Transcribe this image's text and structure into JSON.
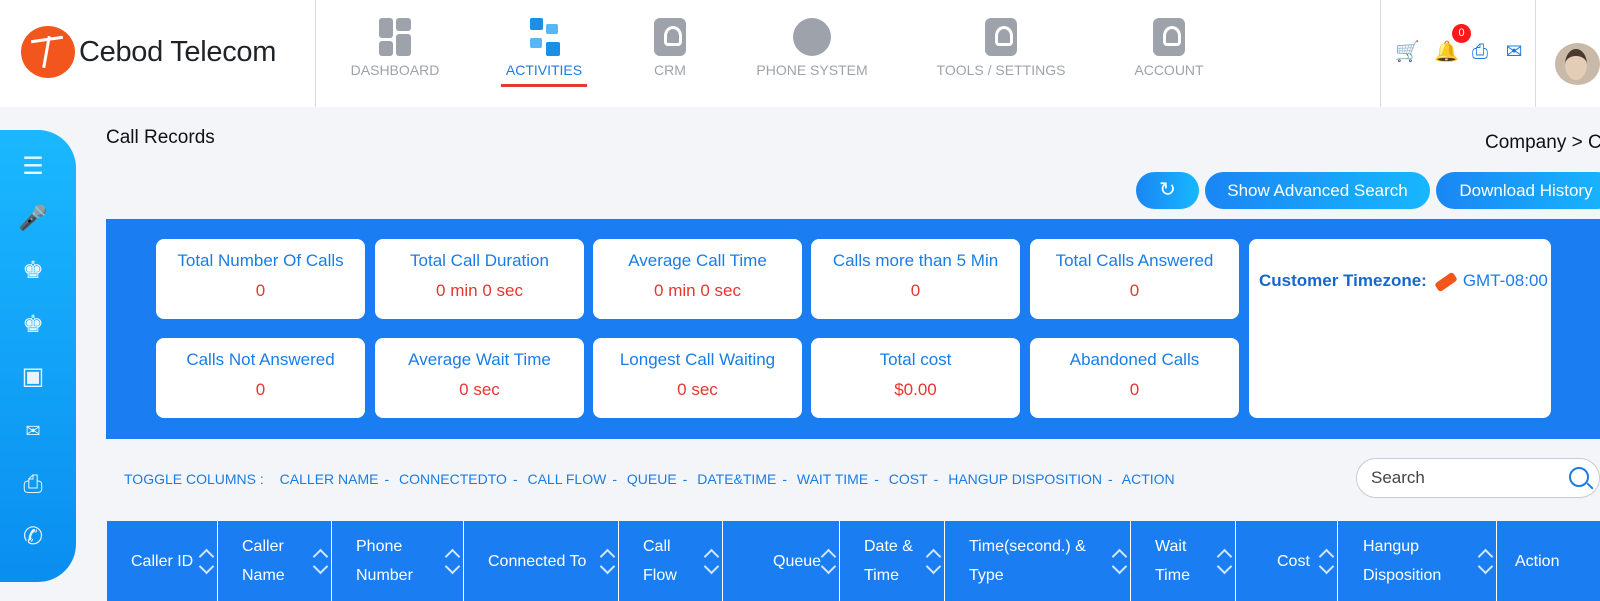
{
  "brand": {
    "name": "Cebod Telecom"
  },
  "nav": [
    {
      "label": "DASHBOARD",
      "icon": "dashboard-icon"
    },
    {
      "label": "ACTIVITIES",
      "icon": "activities-icon",
      "active": true
    },
    {
      "label": "CRM",
      "icon": "crm-icon"
    },
    {
      "label": "PHONE SYSTEM",
      "icon": "phone-system-icon"
    },
    {
      "label": "TOOLS / SETTINGS",
      "icon": "tools-icon"
    },
    {
      "label": "ACCOUNT",
      "icon": "account-icon"
    }
  ],
  "header_icons": [
    "cart-icon",
    "bell-icon",
    "printer-icon",
    "mail-icon"
  ],
  "notification_count": "0",
  "page": {
    "title": "Call Records",
    "breadcrumb": "Company > C"
  },
  "actions": {
    "refresh_icon": "refresh-icon",
    "advanced_search": "Show Advanced Search",
    "download": "Download History"
  },
  "stats": [
    {
      "label": "Total Number Of Calls",
      "value": "0"
    },
    {
      "label": "Total Call Duration",
      "value": "0 min 0 sec"
    },
    {
      "label": "Average Call Time",
      "value": "0 min 0 sec"
    },
    {
      "label": "Calls more than 5 Min",
      "value": "0"
    },
    {
      "label": "Total Calls Answered",
      "value": "0"
    },
    {
      "label": "Calls Not Answered",
      "value": "0"
    },
    {
      "label": "Average Wait Time",
      "value": "0 sec"
    },
    {
      "label": "Longest Call Waiting",
      "value": "0 sec"
    },
    {
      "label": "Total cost",
      "value": "$0.00"
    },
    {
      "label": "Abandoned Calls",
      "value": "0"
    }
  ],
  "timezone": {
    "label": "Customer Timezone:",
    "value": "GMT-08:00"
  },
  "toggle": {
    "label": "TOGGLE COLUMNS :",
    "columns": [
      "CALLER NAME",
      "CONNECTEDTO",
      "CALL FLOW",
      "QUEUE",
      "DATE&TIME",
      "WAIT TIME",
      "COST",
      "HANGUP DISPOSITION",
      "ACTION"
    ]
  },
  "search": {
    "placeholder": "Search"
  },
  "table": {
    "headers": [
      {
        "line1": "Caller ID",
        "line2": ""
      },
      {
        "line1": "Caller",
        "line2": "Name"
      },
      {
        "line1": "Phone",
        "line2": "Number"
      },
      {
        "line1": "Connected To",
        "line2": ""
      },
      {
        "line1": "Call",
        "line2": "Flow"
      },
      {
        "line1": "Queue",
        "line2": ""
      },
      {
        "line1": "Date &",
        "line2": "Time"
      },
      {
        "line1": "Time(second.) &",
        "line2": "Type"
      },
      {
        "line1": "Wait",
        "line2": "Time"
      },
      {
        "line1": "Cost",
        "line2": ""
      },
      {
        "line1": "Hangup",
        "line2": "Disposition"
      },
      {
        "line1": "Action",
        "line2": ""
      }
    ]
  },
  "colors": {
    "accent": "#1a7ef2",
    "value_red": "#e5362f",
    "brand_orange": "#f2561d"
  }
}
